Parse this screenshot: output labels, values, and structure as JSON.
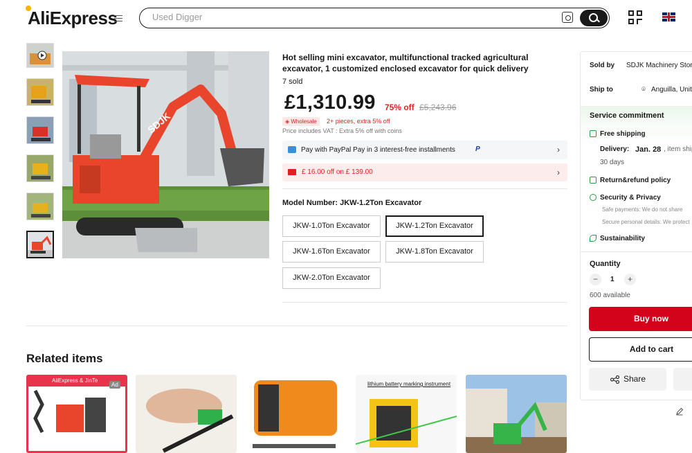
{
  "header": {
    "logo": "AliExpress",
    "search_placeholder": "Used Digger"
  },
  "product": {
    "title": "Hot selling mini excavator, multifunctional tracked agricultural excavator, 1 customized enclosed excavator for quick delivery",
    "sold": "7 sold",
    "price": "£1,310.99",
    "discount": "75% off",
    "original_price": "£5,243.96",
    "wholesale_badge": "Wholesale",
    "wholesale_note": "2+ pieces, extra 5% off",
    "vat_note": "Price includes VAT : Extra 5% off with coins",
    "paypal_text": "Pay with PayPal Pay in 3 interest-free installments",
    "paypal_logo": "P",
    "coupon_text": "£ 16.00 off on  £ 139.00",
    "model_label": "Model Number: JKW-1.2Ton Excavator",
    "model_options": [
      "JKW-1.0Ton Excavator",
      "JKW-1.2Ton Excavator",
      "JKW-1.6Ton Excavator",
      "JKW-1.8Ton Excavator",
      "JKW-2.0Ton Excavator"
    ],
    "selected_option": "JKW-1.2Ton Excavator",
    "main_image_brand": "SDJK"
  },
  "related": {
    "heading": "Related items",
    "cards": [
      {
        "banner": "AliExpress & JinTe",
        "badge": "Ad"
      },
      {
        "banner": ""
      },
      {
        "banner": ""
      },
      {
        "banner": "lithium battery marking instrument"
      },
      {
        "banner": ""
      }
    ]
  },
  "sidebar": {
    "sold_by_label": "Sold by",
    "sold_by_value": "SDJK Machinery Store",
    "ship_to_label": "Ship to",
    "ship_to_value": "Anguilla, United",
    "service_title": "Service commitment",
    "free_shipping": "Free shipping",
    "delivery_label": "Delivery:",
    "delivery_date": "Jan. 28",
    "delivery_tail": ", item ships",
    "return_days": "30 days",
    "return_refund": "Return&refund policy",
    "security": "Security & Privacy",
    "safe_payments": "Safe payments: We do not share",
    "secure_details": "Secure personal details: We protect",
    "sustainability": "Sustainability",
    "quantity_label": "Quantity",
    "quantity_value": "1",
    "available": "600 available",
    "buy_now": "Buy now",
    "add_to_cart": "Add to cart",
    "share": "Share"
  },
  "colors": {
    "accent_red": "#d3031c",
    "discount_red": "#e02020",
    "excavator_orange": "#e8452c",
    "service_green": "#2b9a3e"
  }
}
